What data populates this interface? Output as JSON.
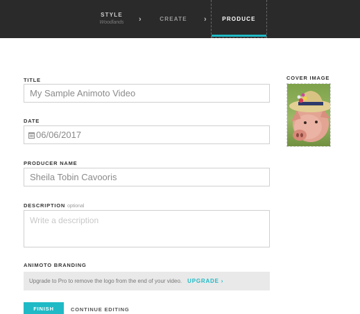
{
  "steps": {
    "style": {
      "label": "STYLE",
      "sub": "Woodlands"
    },
    "create": {
      "label": "CREATE"
    },
    "produce": {
      "label": "PRODUCE"
    },
    "separator_glyph": "›"
  },
  "form": {
    "title": {
      "label": "TITLE",
      "value": "My Sample Animoto Video"
    },
    "date": {
      "label": "DATE",
      "value": "06/06/2017"
    },
    "producer": {
      "label": "PRODUCER NAME",
      "value": "Sheila Tobin Cavooris"
    },
    "description": {
      "label": "DESCRIPTION",
      "optional": "optional",
      "placeholder": "Write a description"
    }
  },
  "branding": {
    "label": "ANIMOTO BRANDING",
    "message": "Upgrade to Pro to remove the logo from the end of your video.",
    "upgrade_label": "UPGRADE ›"
  },
  "actions": {
    "finish_label": "FINISH",
    "continue_label": "CONTINUE EDITING"
  },
  "cover": {
    "label": "COVER IMAGE"
  },
  "colors": {
    "accent": "#1fbac6",
    "topbar": "#2a2a2a"
  }
}
